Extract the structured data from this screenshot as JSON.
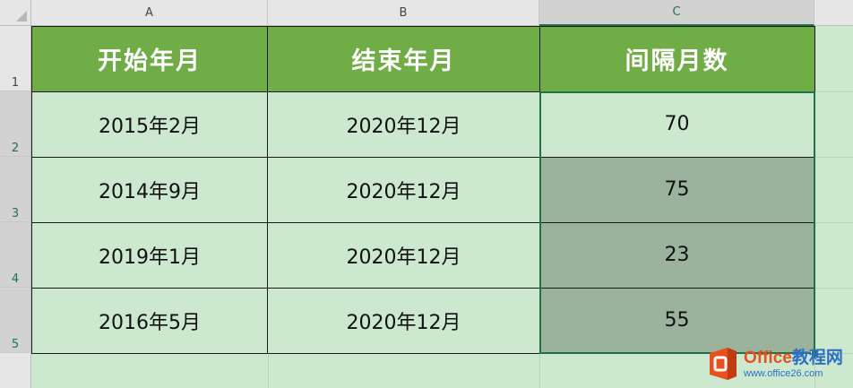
{
  "columns": [
    "A",
    "B",
    "C"
  ],
  "rows": [
    "1",
    "2",
    "3",
    "4",
    "5"
  ],
  "table": {
    "headers": [
      "开始年月",
      "结束年月",
      "间隔月数"
    ],
    "rows": [
      [
        "2015年2月",
        "2020年12月",
        "70"
      ],
      [
        "2014年9月",
        "2020年12月",
        "75"
      ],
      [
        "2019年1月",
        "2020年12月",
        "23"
      ],
      [
        "2016年5月",
        "2020年12月",
        "55"
      ]
    ]
  },
  "colors": {
    "header_fill": "#70ad47",
    "sheet_bg": "#cce8cf",
    "selection_fill": "#9bb39d",
    "selection_border": "#217346"
  },
  "watermark": {
    "brand_part1": "Office",
    "brand_part2": "教程网",
    "url": "www.office26.com",
    "icon": "office-logo-icon"
  }
}
